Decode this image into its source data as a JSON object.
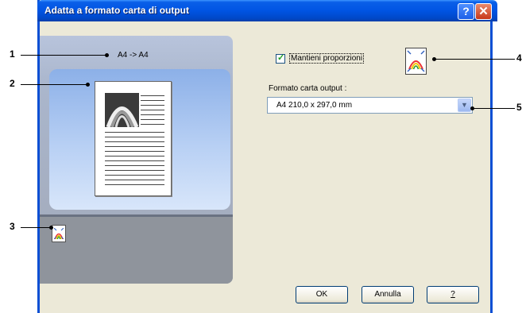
{
  "window": {
    "title": "Adatta a formato carta di output",
    "help_button": "?",
    "close_button": "✕"
  },
  "preview": {
    "size_mapping": "A4 -> A4"
  },
  "options": {
    "keep_proportions_label": "Mantieni proporzioni",
    "keep_proportions_checked": true,
    "output_paper_label": "Formato carta output :",
    "output_paper_value": "A4   210,0 x 297,0 mm"
  },
  "buttons": {
    "ok": "OK",
    "cancel": "Annulla",
    "help": "?"
  },
  "callouts": [
    "1",
    "2",
    "3",
    "4",
    "5"
  ]
}
